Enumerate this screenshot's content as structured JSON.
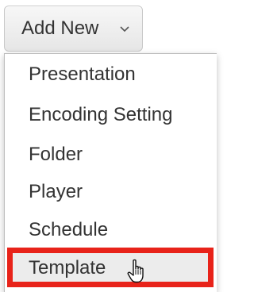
{
  "button": {
    "label": "Add New",
    "icon": "chevron-down-icon"
  },
  "menu": {
    "items": [
      {
        "label": "Presentation"
      },
      {
        "label": "Encoding Setting"
      },
      {
        "label": "Folder"
      },
      {
        "label": "Player"
      },
      {
        "label": "Schedule"
      },
      {
        "label": "Template",
        "highlighted": true
      }
    ]
  },
  "cursor": {
    "icon": "pointer-hand-icon"
  },
  "colors": {
    "highlight_border": "#e8231a",
    "highlight_fill": "#ececec",
    "text": "#333333"
  }
}
